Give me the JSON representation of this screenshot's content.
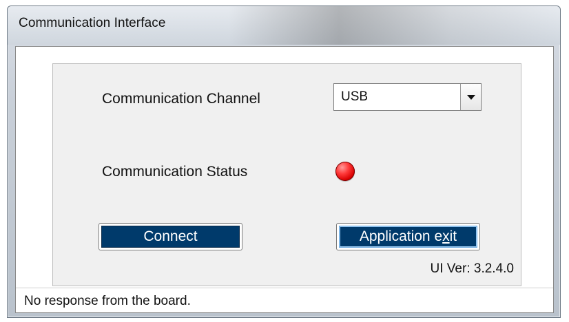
{
  "window": {
    "title": "Communication Interface"
  },
  "form": {
    "channel_label": "Communication Channel",
    "channel_value": "USB",
    "status_label": "Communication Status",
    "status_led_color": "#ff2b2b"
  },
  "buttons": {
    "connect_label": "Connect",
    "exit_label_prefix": "Application e",
    "exit_label_underlined": "x",
    "exit_label_suffix": "it"
  },
  "footer": {
    "version": "UI Ver: 3.2.4.0",
    "status_message": "No response from the board."
  },
  "icons": {
    "combo_dropdown": "triangle-down-icon",
    "status_indicator": "status-led-icon"
  }
}
